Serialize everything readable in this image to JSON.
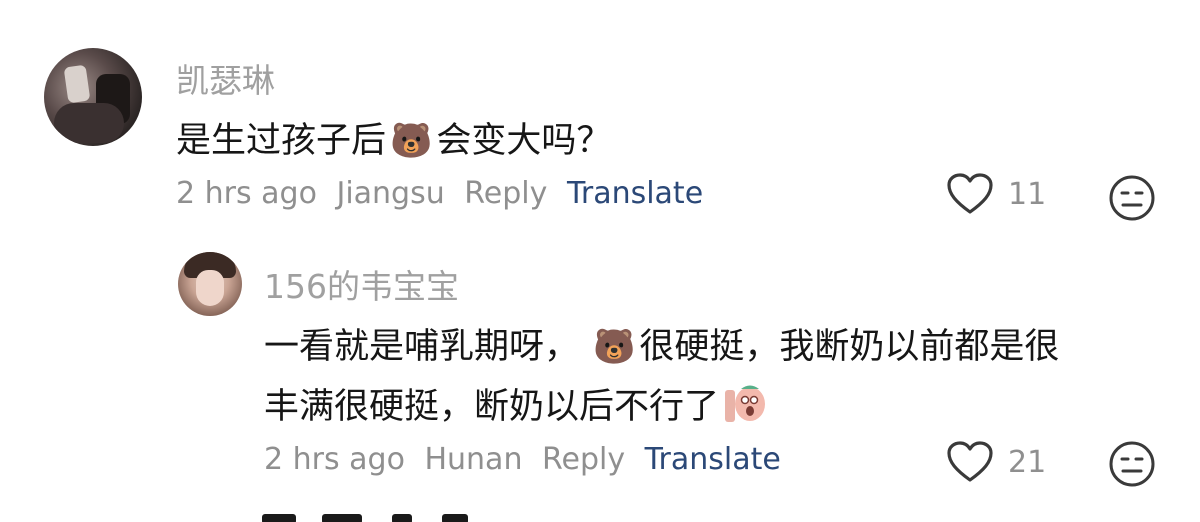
{
  "comments": [
    {
      "username": "凯瑟琳",
      "text_before": "是生过孩子后",
      "emoji": "🐻",
      "text_after": "会变大吗？",
      "time": "2 hrs ago",
      "location": "Jiangsu",
      "reply_label": "Reply",
      "translate_label": "Translate",
      "likes": "11",
      "like_icon": "heart-outline-icon",
      "more_icon": "face-icon"
    }
  ],
  "reply": {
    "username": "156的韦宝宝",
    "line1_before": "一看就是哺乳期呀，",
    "emoji": "🐻",
    "line1_after": "很硬挺，我断奶以前都是很",
    "line2": "丰满很硬挺，断奶以后不行了",
    "sticker": "crying-sticker",
    "time": "2 hrs ago",
    "location": "Hunan",
    "reply_label": "Reply",
    "translate_label": "Translate",
    "likes": "21",
    "like_icon": "heart-outline-icon",
    "more_icon": "face-icon"
  },
  "colors": {
    "username": "#a0a0a0",
    "meta": "#8f8f8f",
    "translate": "#2b4877",
    "text": "#161616"
  }
}
